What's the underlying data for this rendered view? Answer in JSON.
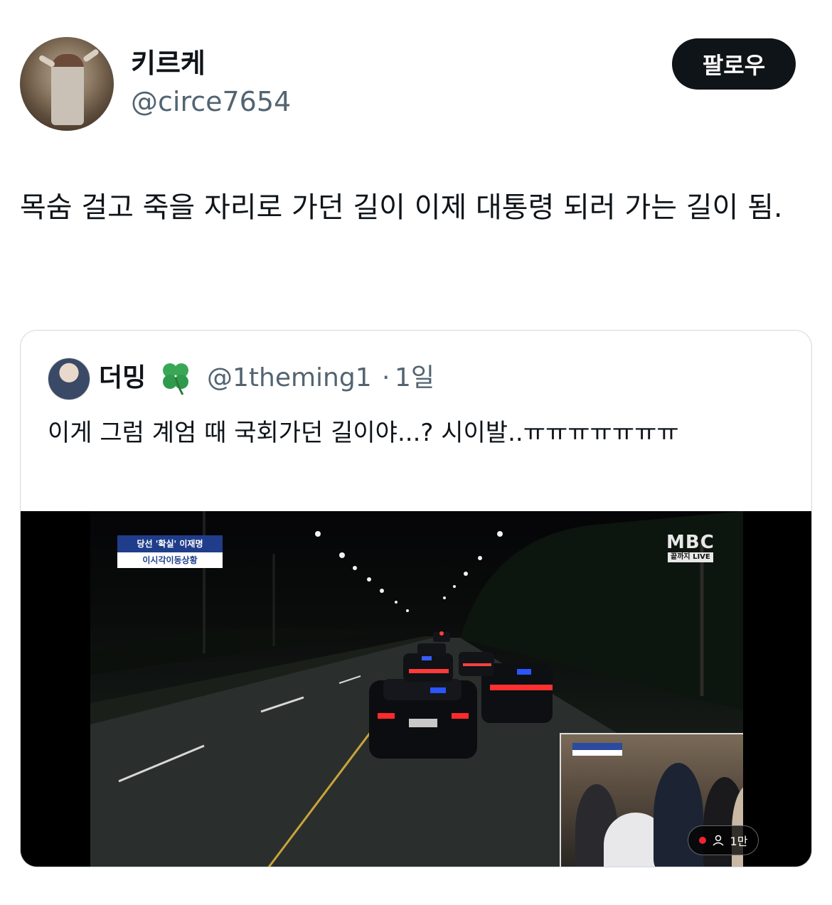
{
  "author": {
    "display_name": "키르케",
    "handle": "@circe7654",
    "follow_label": "팔로우"
  },
  "tweet": {
    "text": "목숨 걸고 죽을 자리로 가던 길이 이제 대통령 되러 가는 길이 됨."
  },
  "quoted": {
    "display_name": "더밍",
    "emoji_icon": "four-leaf-clover",
    "handle": "@1theming1",
    "separator": "·",
    "time": "1일",
    "text": "이게 그럼 계엄 때 국회가던 길이야...? 시이발..ㅠㅠㅠㅠㅠㅠㅠ",
    "video": {
      "overlay_title": "당선 '확실' 이재명",
      "overlay_subtitle": "이시각이동상황",
      "broadcaster": "MBC",
      "broadcaster_tag": "끝까지 LIVE",
      "viewer_count": "1만"
    }
  },
  "colors": {
    "text_primary": "#0f1419",
    "text_secondary": "#536471",
    "border": "#cfd9de",
    "live_dot": "#f4212e",
    "overlay_blue": "#1f3d8a"
  }
}
